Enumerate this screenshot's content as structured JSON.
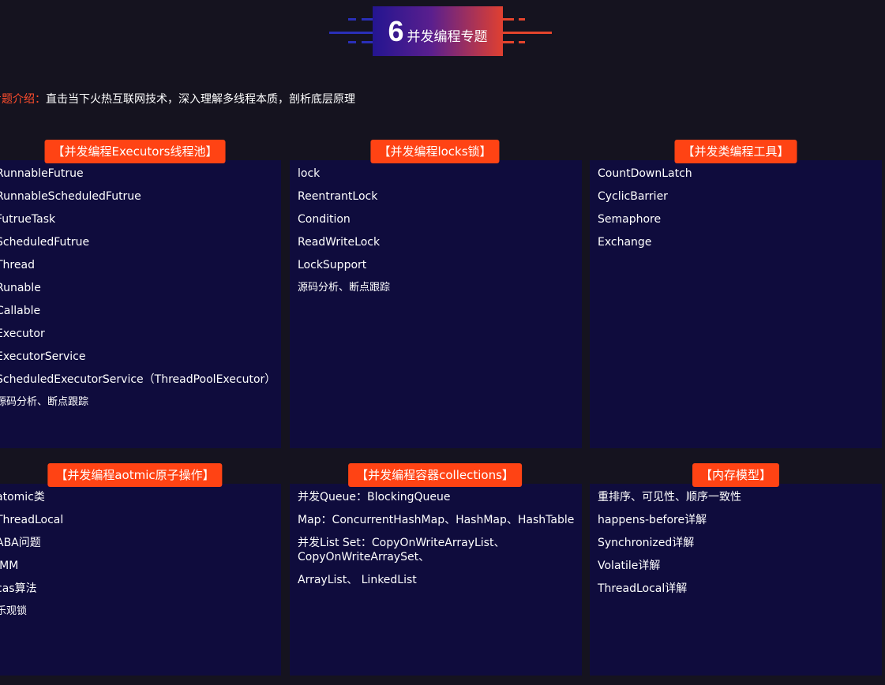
{
  "header": {
    "number": "6",
    "title": "并发编程专题"
  },
  "intro": {
    "label": "专题介绍：",
    "text": "直击当下火热互联网技术，深入理解多线程本质，剖析底层原理"
  },
  "colors": {
    "background": "#15131f",
    "card": "#0f0c3d",
    "accent": "#ff4314"
  },
  "cards": [
    {
      "title": "【并发编程Executors线程池】",
      "items": [
        "RunnableFutrue",
        "RunnableScheduledFutrue",
        "FutrueTask",
        "ScheduledFutrue",
        "Thread",
        "Runable",
        "Callable",
        "Executor",
        "ExecutorService",
        "ScheduledExecutorService（ThreadPoolExecutor）",
        "源码分析、断点跟踪"
      ]
    },
    {
      "title": "【并发编程locks锁】",
      "items": [
        "lock",
        "ReentrantLock",
        "Condition",
        "ReadWriteLock",
        "LockSupport",
        "源码分析、断点跟踪"
      ]
    },
    {
      "title": "【并发类编程工具】",
      "items": [
        "CountDownLatch",
        "CyclicBarrier",
        "Semaphore",
        "Exchange"
      ]
    },
    {
      "title": "【并发编程aotmic原子操作】",
      "items": [
        "atomic类",
        "ThreadLocal",
        "ABA问题",
        "JMM",
        "cas算法",
        "乐观锁"
      ]
    },
    {
      "title": "【并发编程容器collections】",
      "items": [
        "并发Queue：BlockingQueue",
        "Map：ConcurrentHashMap、HashMap、HashTable",
        "并发List Set：CopyOnWriteArrayList、CopyOnWriteArraySet、",
        "ArrayList、 LinkedList"
      ]
    },
    {
      "title": "【内存模型】",
      "items": [
        "重排序、可见性、顺序一致性",
        "happens-before详解",
        "Synchronized详解",
        "Volatile详解",
        "ThreadLocal详解"
      ]
    }
  ]
}
